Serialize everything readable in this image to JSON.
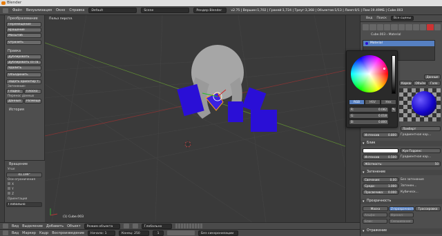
{
  "window": {
    "title": "Blender"
  },
  "topbar": {
    "menus": [
      "Файл",
      "Визуализация",
      "Окно",
      "Справка"
    ],
    "layout": "Default",
    "scene": "Scene",
    "engine": "Рендер Blender",
    "stats": "v2.75 | Вершин:1,702 | Граней:1,724 | Треуг:3,368 | Объектов:1/13 | Ламп:0/1 | Пам:19.49МБ | Cube.003"
  },
  "toolshelf": {
    "transform_title": "Преобразование",
    "transform_buttons": [
      "Перемещение",
      "Вращение",
      "Масштаб",
      "Отразить"
    ],
    "edit_title": "Правка",
    "edit_buttons": [
      "Дублировать",
      "Дублировать со св...",
      "Удалить",
      "Объединить",
      "Задать ориентир т..."
    ],
    "shading_label": "Затенение:",
    "shading_buttons": [
      "Гладко",
      "Плоско"
    ],
    "data_transfer_label": "Перенос данных",
    "data_buttons": [
      "Данные",
      "Размеще..."
    ],
    "history_title": "История"
  },
  "operator": {
    "title": "Вращение",
    "angle_label": "Угол",
    "angle_value": "41.199°",
    "constraint_label": "Оси ограничения",
    "axes": [
      "X",
      "Y",
      "Z"
    ],
    "orientation_label": "Ориентация",
    "orientation_value": "Глобально"
  },
  "viewport": {
    "view_label": "Польз перспл.",
    "object_label": "(1) Cube.003"
  },
  "outliner": {
    "tabs": [
      "Вид",
      "Поиск",
      "Все сцены"
    ]
  },
  "properties": {
    "object_name": "Cube.003",
    "material_slot": "Material",
    "material_name": "Material",
    "tabs": [
      "Поверхн",
      "Каркас",
      "Объём",
      "Гало"
    ],
    "data_label": "Данные",
    "diffuse_shader": "Ламберт",
    "intensity_label": "Интенсив",
    "intensity_value": "0.800",
    "ramp_label": "Градиентная кар...",
    "specular_title": "Блик",
    "specular_shader": "Кук-Торренс",
    "spec_intensity_value": "0.500",
    "hardness_label": "Жёсткость:",
    "hardness_value": "50",
    "shading_title": "Затенение",
    "emit_label": "Свечение:",
    "emit_value": "0.00",
    "shadeless_label": "Без затенения",
    "ambient_label": "Среда:",
    "ambient_value": "1.000",
    "tangent_label": "Затенен...",
    "translucency_label": "Просвечива:",
    "translucency_value": "0.000",
    "cubic_label": "Кубическ...",
    "transparency_title": "Прозрачность",
    "transparency_modes": [
      "Маска",
      "Z-прозрачность",
      "Трассировка"
    ],
    "alpha_label": "Альфа:",
    "specular_alpha_label": "Блик:",
    "fresnel_label": "Френел:",
    "blend_label": "Смешивание:",
    "reflection_title": "Отражение"
  },
  "color_picker": {
    "modes": [
      "RGB",
      "HSV",
      "Hex"
    ],
    "r_label": "R:",
    "r_value": "0.082",
    "g_label": "G:",
    "g_value": "0.018",
    "b_label": "B:",
    "b_value": "0.800",
    "swatch_color": "#1505cc"
  },
  "header3d": {
    "menus": [
      "Вид",
      "Выделение",
      "Добавить",
      "Объект"
    ],
    "mode": "Режим объекта",
    "orientation": "Глобально"
  },
  "timeline": {
    "menus": [
      "Вид",
      "Маркер",
      "Кадр",
      "Воспроизведение"
    ],
    "start_label": "Начало:",
    "start_value": "1",
    "end_label": "Конец:",
    "end_value": "250",
    "current_value": "1",
    "sync": "Без синхронизации"
  },
  "colors": {
    "accent": "#5680c2",
    "object_blue": "#2a0fd6",
    "sphere_gray": "#a6a6a6",
    "orange": "#e87d0d"
  }
}
